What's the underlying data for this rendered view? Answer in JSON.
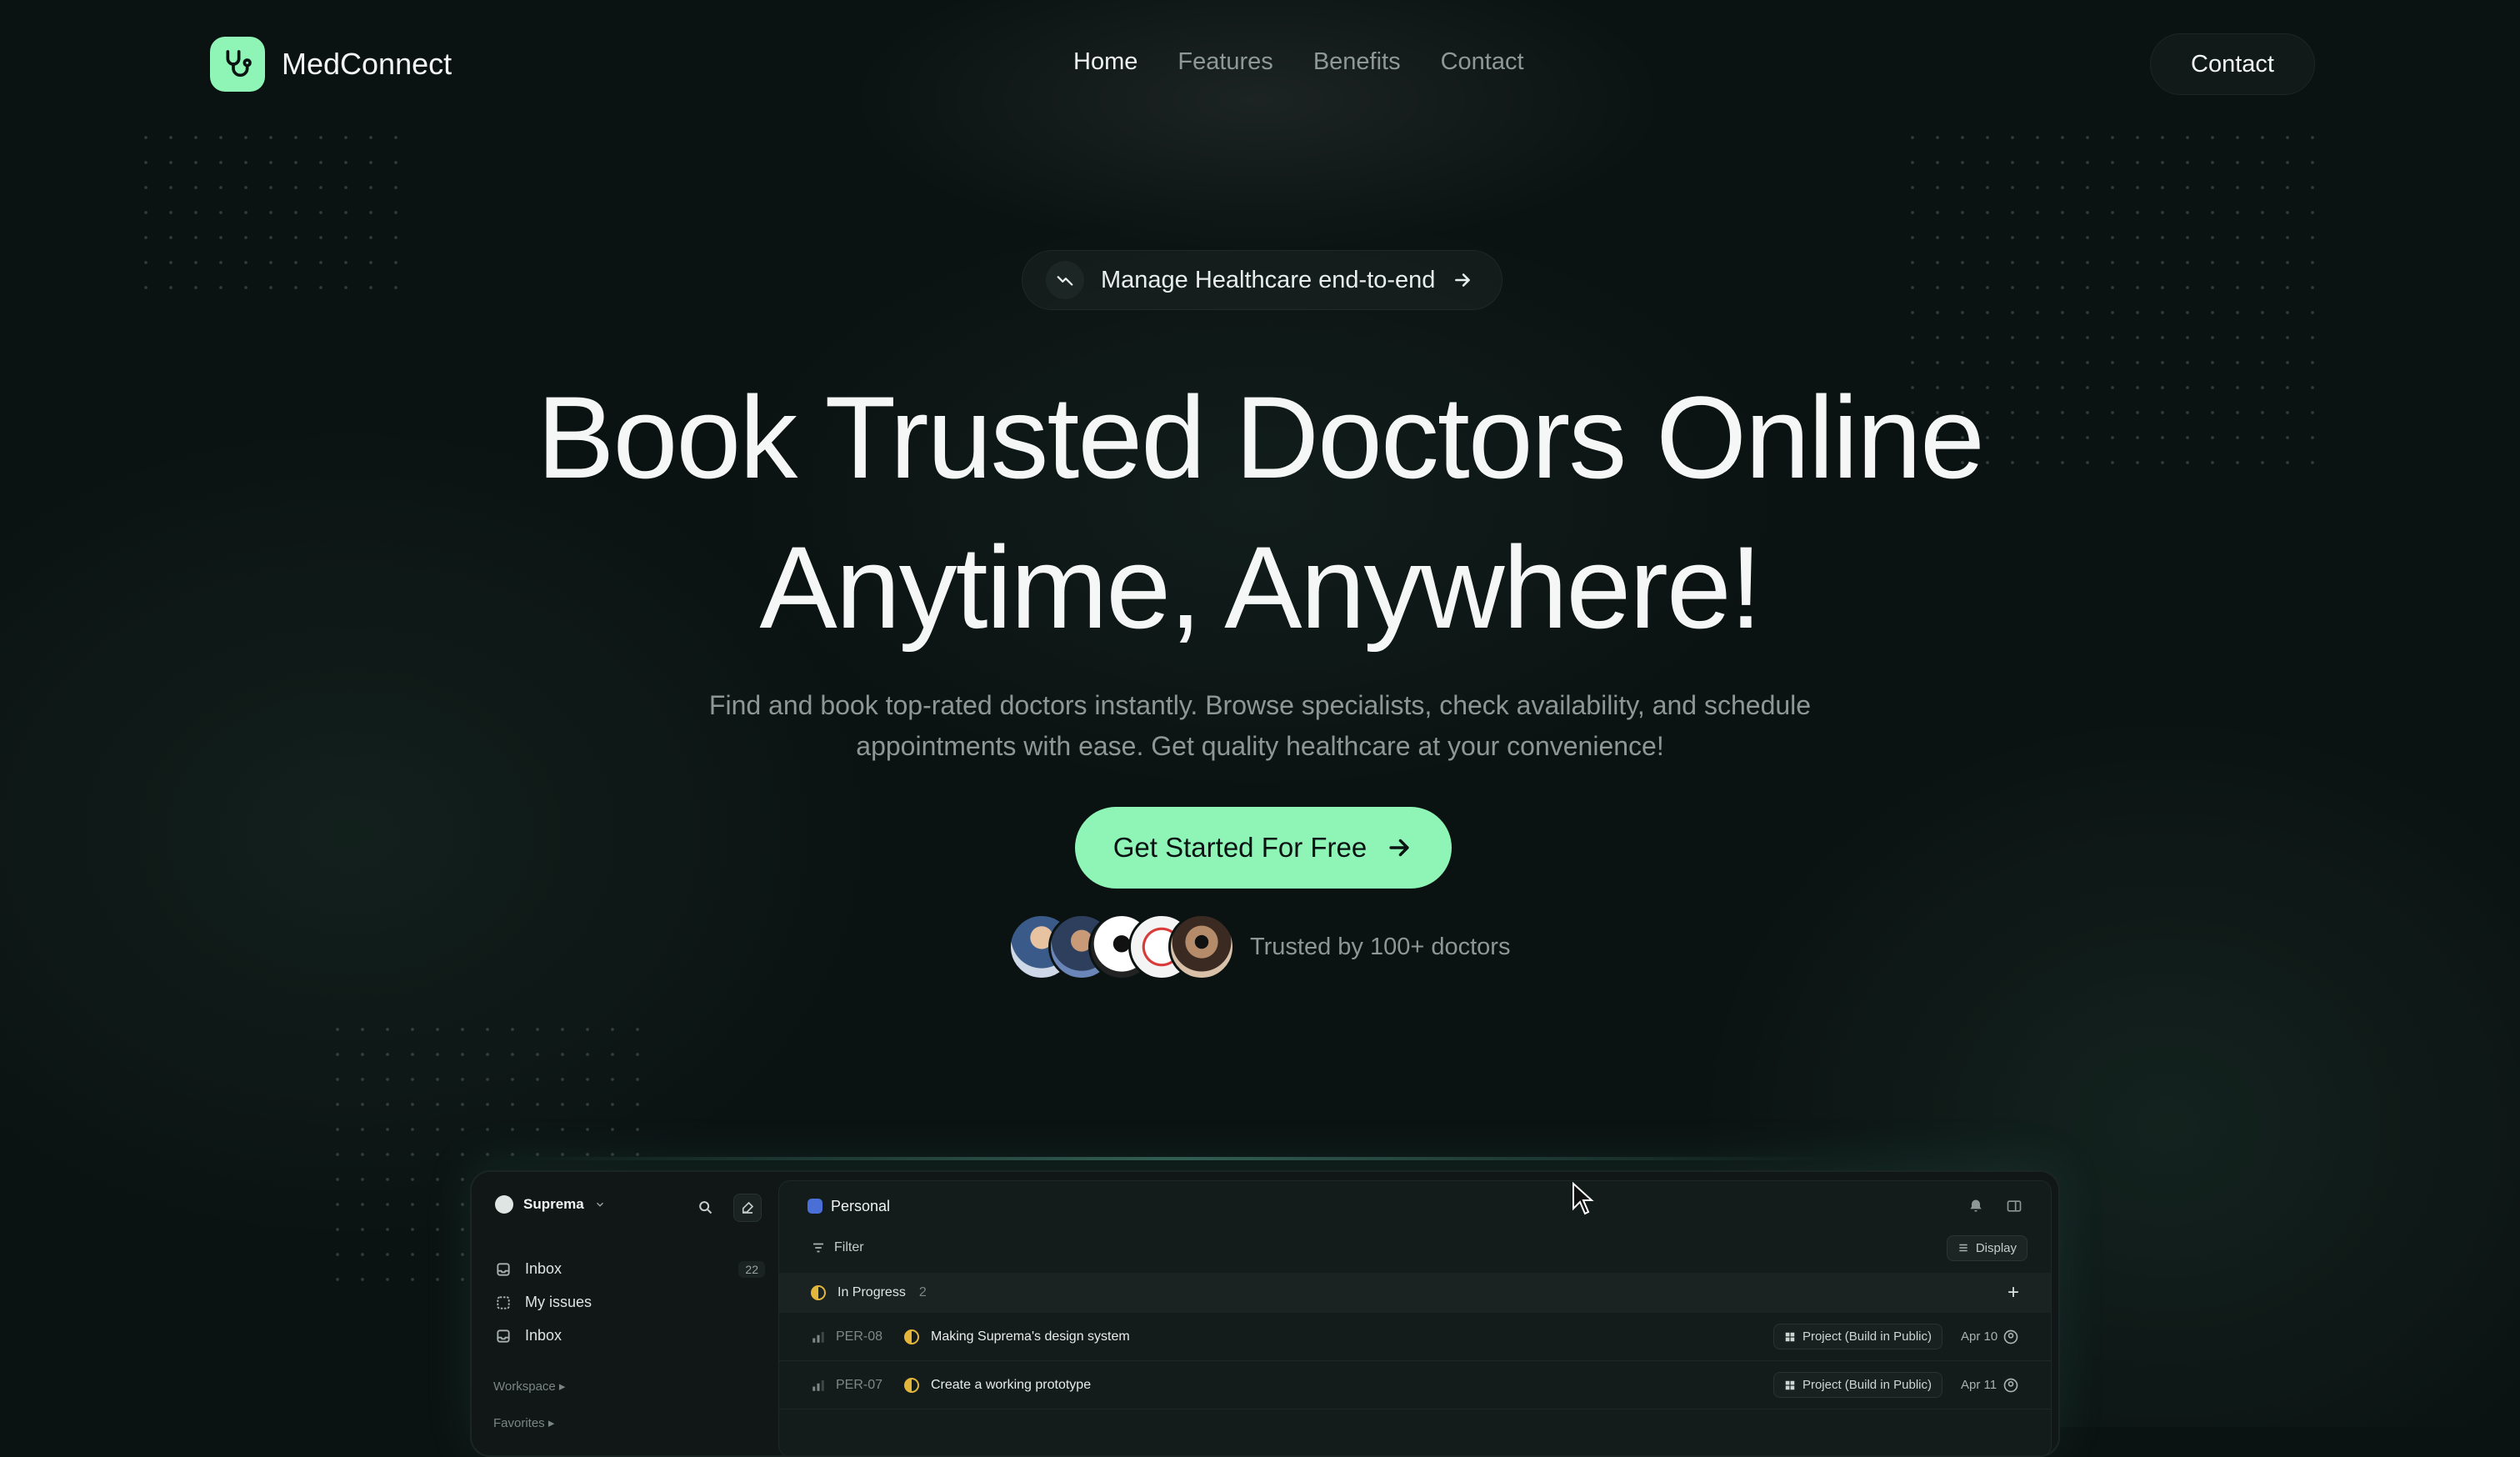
{
  "brand": {
    "name": "MedConnect",
    "accent": "#8ef5b7"
  },
  "nav": {
    "links": [
      "Home",
      "Features",
      "Benefits",
      "Contact"
    ],
    "active": "Home",
    "contact_button": "Contact"
  },
  "hero": {
    "pill": "Manage Healthcare end-to-end",
    "title_line1": "Book Trusted Doctors Online",
    "title_line2": "Anytime, Anywhere!",
    "subtitle": "Find and book top-rated doctors instantly. Browse specialists, check availability, and schedule appointments with ease. Get quality healthcare at your convenience!",
    "cta": "Get Started For Free",
    "trust_text": "Trusted by 100+ doctors"
  },
  "app_preview": {
    "workspace": "Suprema",
    "sidebar_items": [
      {
        "label": "Inbox",
        "count": "22"
      },
      {
        "label": "My issues"
      },
      {
        "label": "Inbox"
      }
    ],
    "section_workspace": "Workspace",
    "section_favorites": "Favorites",
    "team": "Personal",
    "filter": "Filter",
    "display": "Display",
    "group": {
      "label": "In Progress",
      "count": "2"
    },
    "issues": [
      {
        "id": "PER-08",
        "title": "Making Suprema's design system",
        "project": "Project (Build in Public)",
        "date": "Apr 10"
      },
      {
        "id": "PER-07",
        "title": "Create a working prototype",
        "project": "Project (Build in Public)",
        "date": "Apr 11"
      }
    ]
  }
}
